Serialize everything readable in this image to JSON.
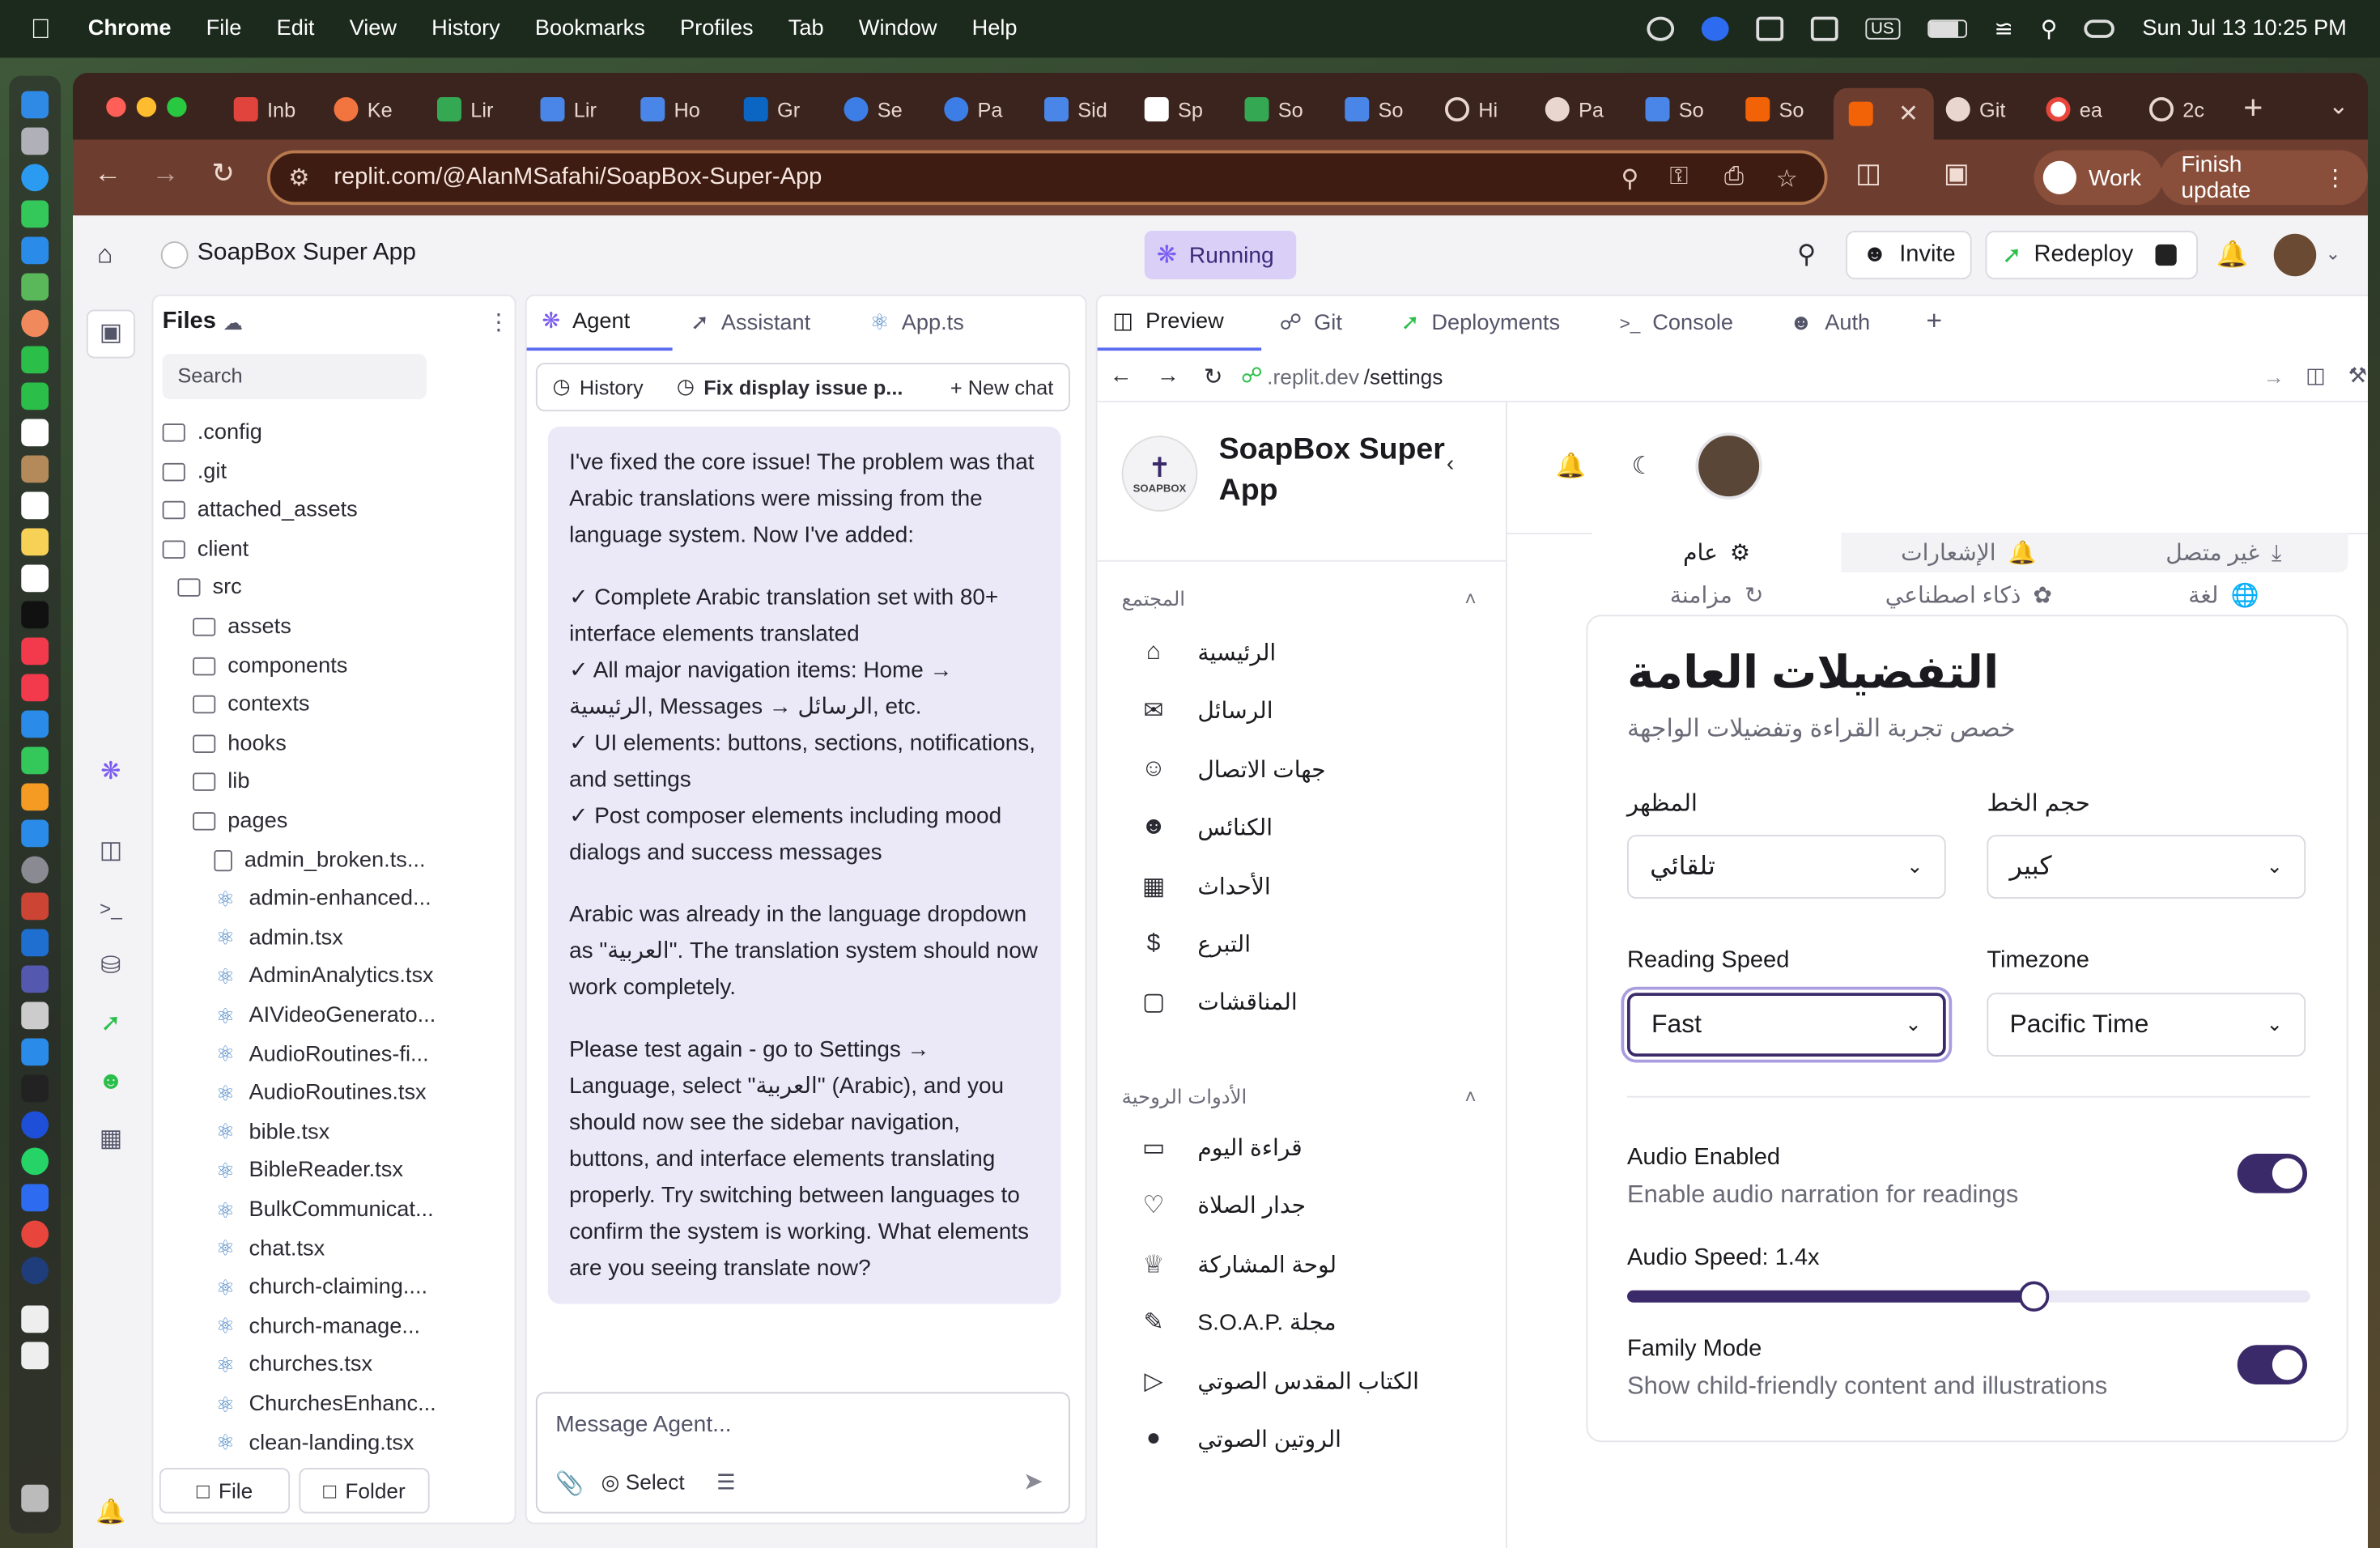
{
  "os_menubar": {
    "app": "Chrome",
    "items": [
      "File",
      "Edit",
      "View",
      "History",
      "Bookmarks",
      "Profiles",
      "Tab",
      "Window",
      "Help"
    ],
    "input_source": "US",
    "datetime": "Sun Jul 13  10:25 PM"
  },
  "browser": {
    "tabs": [
      {
        "label": "Inb"
      },
      {
        "label": "Ke"
      },
      {
        "label": "Lir"
      },
      {
        "label": "Lir"
      },
      {
        "label": "Ho"
      },
      {
        "label": "Gr"
      },
      {
        "label": "Se"
      },
      {
        "label": "Pa"
      },
      {
        "label": "Sid"
      },
      {
        "label": "Sp"
      },
      {
        "label": "So"
      },
      {
        "label": "So"
      },
      {
        "label": "Hi"
      },
      {
        "label": "Pa"
      },
      {
        "label": "So"
      },
      {
        "label": "So"
      },
      {
        "label": ""
      },
      {
        "label": "Git"
      },
      {
        "label": "ea"
      },
      {
        "label": "2c"
      }
    ],
    "url": "replit.com/@AlanMSafahi/SoapBox-Super-App",
    "profile_label": "Work",
    "update_label": "Finish update"
  },
  "replit": {
    "project_name": "SoapBox Super App",
    "status": "Running",
    "invite_label": "Invite",
    "redeploy_label": "Redeploy",
    "files": {
      "title": "Files",
      "search_placeholder": "Search",
      "tree": [
        {
          "name": ".config",
          "type": "folder",
          "depth": 0
        },
        {
          "name": ".git",
          "type": "folder",
          "depth": 0
        },
        {
          "name": "attached_assets",
          "type": "folder",
          "depth": 0
        },
        {
          "name": "client",
          "type": "folder",
          "depth": 0
        },
        {
          "name": "src",
          "type": "folder",
          "depth": 1
        },
        {
          "name": "assets",
          "type": "folder",
          "depth": 2
        },
        {
          "name": "components",
          "type": "folder",
          "depth": 2
        },
        {
          "name": "contexts",
          "type": "folder",
          "depth": 2
        },
        {
          "name": "hooks",
          "type": "folder",
          "depth": 2
        },
        {
          "name": "lib",
          "type": "folder",
          "depth": 2
        },
        {
          "name": "pages",
          "type": "folder",
          "depth": 2
        },
        {
          "name": "admin_broken.ts...",
          "type": "file",
          "depth": 3
        },
        {
          "name": "admin-enhanced...",
          "type": "react",
          "depth": 3
        },
        {
          "name": "admin.tsx",
          "type": "react",
          "depth": 3
        },
        {
          "name": "AdminAnalytics.tsx",
          "type": "react",
          "depth": 3
        },
        {
          "name": "AIVideoGenerato...",
          "type": "react",
          "depth": 3
        },
        {
          "name": "AudioRoutines-fi...",
          "type": "react",
          "depth": 3
        },
        {
          "name": "AudioRoutines.tsx",
          "type": "react",
          "depth": 3
        },
        {
          "name": "bible.tsx",
          "type": "react",
          "depth": 3
        },
        {
          "name": "BibleReader.tsx",
          "type": "react",
          "depth": 3
        },
        {
          "name": "BulkCommunicat...",
          "type": "react",
          "depth": 3
        },
        {
          "name": "chat.tsx",
          "type": "react",
          "depth": 3
        },
        {
          "name": "church-claiming....",
          "type": "react",
          "depth": 3
        },
        {
          "name": "church-manage...",
          "type": "react",
          "depth": 3
        },
        {
          "name": "churches.tsx",
          "type": "react",
          "depth": 3
        },
        {
          "name": "ChurchesEnhanc...",
          "type": "react",
          "depth": 3
        },
        {
          "name": "clean-landing.tsx",
          "type": "react",
          "depth": 3
        }
      ],
      "file_button": "File",
      "folder_button": "Folder"
    },
    "agent_tabs": [
      "Agent",
      "Assistant",
      "App.ts"
    ],
    "agent": {
      "history_label": "History",
      "chat_title": "Fix display issue p...",
      "new_chat_label": "New chat",
      "message_paragraphs": [
        "I've fixed the core issue! The problem was that Arabic translations were missing from the language system. Now I've added:",
        "✓ Complete Arabic translation set with 80+ interface elements translated",
        "✓ All major navigation items: Home → الرئيسية, Messages → الرسائل, etc.",
        "✓ UI elements: buttons, sections, notifications, and settings",
        "✓ Post composer elements including mood dialogs and success messages",
        "Arabic was already in the language dropdown as \"العربية\". The translation system should now work completely.",
        "Please test again - go to Settings → Language, select \"العربية\" (Arabic), and you should now see the sidebar navigation, buttons, and interface elements translating properly. Try switching between languages to confirm the system is working. What elements are you seeing translate now?"
      ],
      "input_placeholder": "Message Agent...",
      "select_label": "Select"
    },
    "preview_tabs": [
      "Preview",
      "Git",
      "Deployments",
      "Console",
      "Auth"
    ],
    "preview_url_prefix": ".replit.dev",
    "preview_url_path": "/settings"
  },
  "site": {
    "brand": "SoapBox Super App",
    "logo_text": "SOAPBOX",
    "sections": [
      {
        "title": "المجتمع",
        "items": [
          {
            "label": "الرئيسية",
            "icon": "home-icon"
          },
          {
            "label": "الرسائل",
            "icon": "mail-icon"
          },
          {
            "label": "جهات الاتصال",
            "icon": "user-plus-icon"
          },
          {
            "label": "الكنائس",
            "icon": "users-icon"
          },
          {
            "label": "الأحداث",
            "icon": "calendar-icon"
          },
          {
            "label": "التبرع",
            "icon": "dollar-icon"
          },
          {
            "label": "المناقشات",
            "icon": "chat-icon"
          }
        ]
      },
      {
        "title": "الأدوات الروحية",
        "items": [
          {
            "label": "قراءة اليوم",
            "icon": "book-icon"
          },
          {
            "label": "جدار الصلاة",
            "icon": "heart-icon"
          },
          {
            "label": "لوحة المشاركة",
            "icon": "trophy-icon"
          },
          {
            "label": "S.O.A.P. مجلة",
            "icon": "pen-icon"
          },
          {
            "label": "الكتاب المقدس الصوتي",
            "icon": "play-icon"
          },
          {
            "label": "الروتين الصوتي",
            "icon": "mic-icon"
          }
        ]
      }
    ],
    "settings_tabs_row1": [
      {
        "label": "عام",
        "icon": "gear-icon"
      },
      {
        "label": "الإشعارات",
        "icon": "bell-icon"
      },
      {
        "label": "غير متصل",
        "icon": "download-icon"
      }
    ],
    "settings_tabs_row2": [
      {
        "label": "مزامنة",
        "icon": "sync-icon"
      },
      {
        "label": "ذكاء اصطناعي",
        "icon": "brain-icon"
      },
      {
        "label": "لغة",
        "icon": "globe-icon"
      }
    ],
    "card": {
      "title": "التفضيلات العامة",
      "subtitle": "خصص تجربة القراءة وتفضيلات الواجهة",
      "theme_label": "المظهر",
      "theme_value": "تلقائي",
      "font_size_label": "حجم الخط",
      "font_size_value": "كبير",
      "reading_speed_label": "Reading Speed",
      "reading_speed_value": "Fast",
      "timezone_label": "Timezone",
      "timezone_value": "Pacific Time",
      "audio_enabled_label": "Audio Enabled",
      "audio_enabled_desc": "Enable audio narration for readings",
      "audio_enabled": true,
      "audio_speed_label": "Audio Speed: 1.4x",
      "audio_speed_fraction": 0.595,
      "family_mode_label": "Family Mode",
      "family_mode_desc": "Show child-friendly content and illustrations",
      "family_mode": true
    }
  },
  "colors": {
    "accent": "#3b2a6a",
    "running_bg": "#d9cff7",
    "browser_toolbar": "#6d3e2f"
  }
}
